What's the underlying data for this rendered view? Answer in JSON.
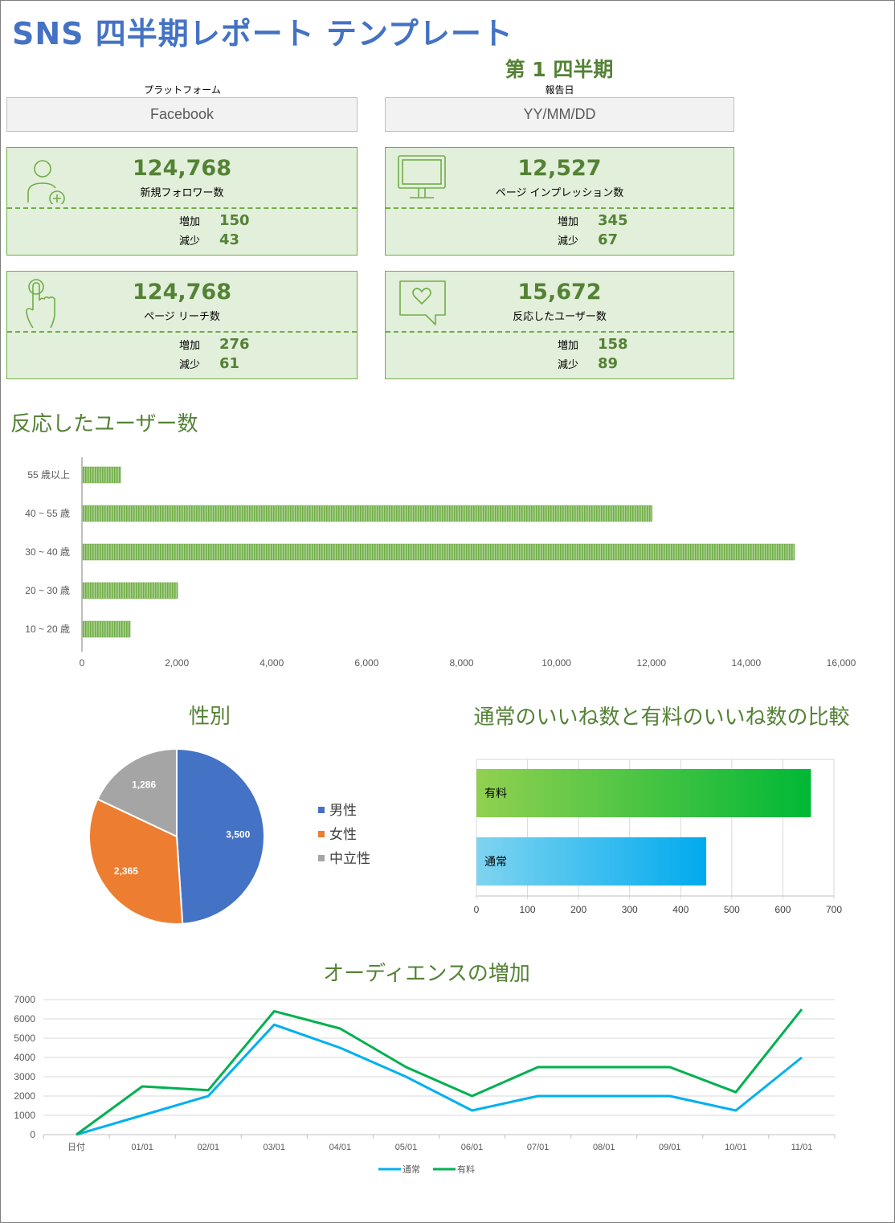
{
  "header": {
    "title": "SNS 四半期レポート テンプレート",
    "quarter": "第 1 四半期",
    "platform_label": "プラットフォーム",
    "platform_value": "Facebook",
    "report_date_label": "報告日",
    "report_date_value": "YY/MM/DD"
  },
  "kpis": [
    {
      "icon": "user-add-icon",
      "value": "124,768",
      "caption": "新規フォロワー数",
      "increase_label": "増加",
      "increase": "150",
      "decrease_label": "減少",
      "decrease": "43"
    },
    {
      "icon": "monitor-icon",
      "value": "12,527",
      "caption": "ページ インプレッション数",
      "increase_label": "増加",
      "increase": "345",
      "decrease_label": "減少",
      "decrease": "67"
    },
    {
      "icon": "hand-pointer-icon",
      "value": "124,768",
      "caption": "ページ リーチ数",
      "increase_label": "増加",
      "increase": "276",
      "decrease_label": "減少",
      "decrease": "61"
    },
    {
      "icon": "heart-speech-bubble-icon",
      "value": "15,672",
      "caption": "反応したユーザー数",
      "increase_label": "増加",
      "increase": "158",
      "decrease_label": "減少",
      "decrease": "89"
    }
  ],
  "colors": {
    "title_blue": "#4472c4",
    "accent_green": "#548235",
    "kpi_fill": "#e2efda",
    "kpi_border": "#70ad47",
    "male": "#4472c4",
    "female": "#ed7d31",
    "neutral": "#a5a5a5",
    "regular": "#00b0f0",
    "paid": "#00b050"
  },
  "chart_data": [
    {
      "id": "engaged-users-by-age",
      "type": "bar",
      "orientation": "horizontal",
      "title": "反応したユーザー数",
      "categories": [
        "55 歳以上",
        "40 ~ 55 歳",
        "30 ~ 40 歳",
        "20 ~ 30 歳",
        "10 ~ 20 歳"
      ],
      "values": [
        800,
        12000,
        15000,
        2000,
        1000
      ],
      "xlim": [
        0,
        16000
      ],
      "xticks": [
        "0",
        "2,000",
        "4,000",
        "6,000",
        "8,000",
        "10,000",
        "12,000",
        "14,000",
        "16,000"
      ],
      "grid": false
    },
    {
      "id": "gender",
      "type": "pie",
      "title": "性別",
      "labels": [
        "男性",
        "女性",
        "中立性"
      ],
      "values": [
        3500,
        2365,
        1286
      ],
      "value_labels": [
        "3,500",
        "2,365",
        "1,286"
      ],
      "legend": "right"
    },
    {
      "id": "likes-comparison",
      "type": "bar",
      "orientation": "horizontal",
      "title": "通常のいいね数と有料のいいね数の比較",
      "categories": [
        "有料",
        "通常"
      ],
      "values": [
        655,
        450
      ],
      "xlim": [
        0,
        700
      ],
      "xticks": [
        "0",
        "100",
        "200",
        "300",
        "400",
        "500",
        "600",
        "700"
      ],
      "grid": true
    },
    {
      "id": "audience-growth",
      "type": "line",
      "title": "オーディエンスの増加",
      "x": [
        "日付",
        "01/01",
        "02/01",
        "03/01",
        "04/01",
        "05/01",
        "06/01",
        "07/01",
        "08/01",
        "09/01",
        "10/01",
        "11/01"
      ],
      "series": [
        {
          "name": "通常",
          "values": [
            0,
            1000,
            2000,
            5700,
            4500,
            3000,
            1250,
            2000,
            2000,
            2000,
            1250,
            4000
          ]
        },
        {
          "name": "有料",
          "values": [
            0,
            2500,
            2300,
            6400,
            5500,
            3500,
            2000,
            3500,
            3500,
            3500,
            2200,
            6500
          ]
        }
      ],
      "ylim": [
        0,
        7000
      ],
      "yticks": [
        "0",
        "1000",
        "2000",
        "3000",
        "4000",
        "5000",
        "6000",
        "7000"
      ],
      "grid": true,
      "legend": "bottom"
    }
  ]
}
